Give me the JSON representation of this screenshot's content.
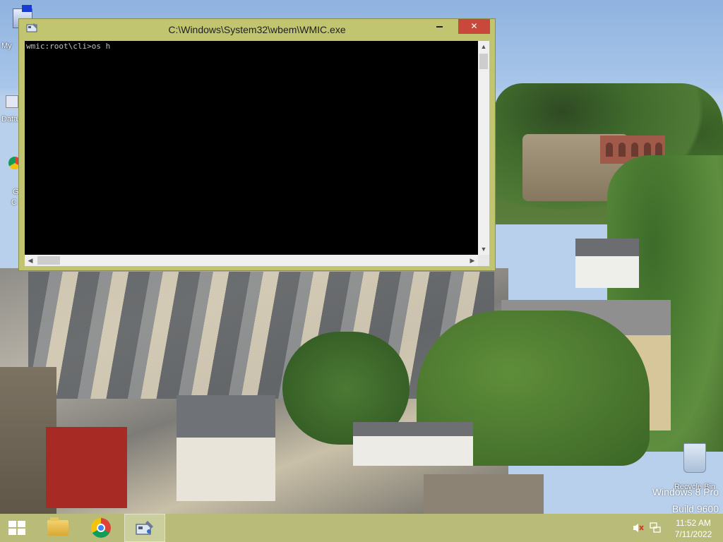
{
  "window": {
    "title": "C:\\Windows\\System32\\wbem\\WMIC.exe",
    "minimize_icon": "minimize-icon",
    "maximize_icon": "maximize-icon",
    "close_icon": "close-icon",
    "close_symbol": "✕"
  },
  "console": {
    "line": "wmic:root\\cli>os h",
    "text_color": "#c0c0c0",
    "background": "#000000"
  },
  "scrollbars": {
    "up_arrow": "▲",
    "down_arrow": "▼",
    "left_arrow": "◀",
    "right_arrow": "▶"
  },
  "desktop_icons": {
    "my_computer_label": "My",
    "data_label": "Data",
    "chrome_label_1": "G",
    "chrome_label_2": "C",
    "recycle_bin_label": "Recycle Bin"
  },
  "watermark": {
    "line1": "Windows 8 Pro",
    "line2": "Build 9600"
  },
  "taskbar": {
    "start_icon": "windows-logo-icon",
    "apps": [
      "file-explorer",
      "google-chrome",
      "wmic-console"
    ],
    "accent": "#b2b66c"
  },
  "tray": {
    "volume_icon": "speaker-muted-icon",
    "network_icon": "network-icon",
    "time": "11:52 AM",
    "date": "7/11/2022"
  },
  "colors": {
    "window_frame": "#c1c570",
    "close_button": "#c9483c"
  }
}
